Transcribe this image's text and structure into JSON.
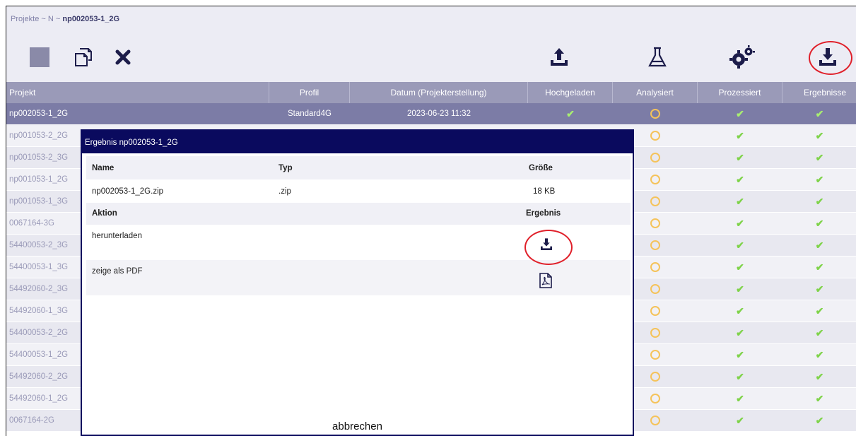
{
  "breadcrumb": {
    "path": "Projekte ~ N ~ ",
    "current": "np002053-1_2G"
  },
  "toolbar": {
    "left_icons": [
      "stop-square-icon",
      "copy-icon",
      "delete-x-icon"
    ],
    "right_icons": [
      "upload-icon",
      "flask-icon",
      "gears-icon",
      "download-icon"
    ]
  },
  "table": {
    "headers": {
      "project": "Projekt",
      "profile": "Profil",
      "date": "Datum (Projekterstellung)",
      "uploaded": "Hochgeladen",
      "analyzed": "Analysiert",
      "processed": "Prozessiert",
      "results": "Ergebnisse"
    },
    "selected": {
      "project": "np002053-1_2G",
      "profile": "Standard4G",
      "date": "2023-06-23 11:32"
    },
    "rows": [
      {
        "project": "np001053-2_2G"
      },
      {
        "project": "np001053-2_3G"
      },
      {
        "project": "np001053-1_2G"
      },
      {
        "project": "np001053-1_3G"
      },
      {
        "project": "0067164-3G"
      },
      {
        "project": "54400053-2_3G"
      },
      {
        "project": "54400053-1_3G"
      },
      {
        "project": "54492060-2_3G"
      },
      {
        "project": "54492060-1_3G"
      },
      {
        "project": "54400053-2_2G"
      },
      {
        "project": "54400053-1_2G"
      },
      {
        "project": "54492060-2_2G"
      },
      {
        "project": "54492060-1_2G"
      },
      {
        "project": "0067164-2G"
      }
    ],
    "status_icons": {
      "check": "✔",
      "pending": "ring"
    }
  },
  "modal": {
    "title": "Ergebnis np002053-1_2G",
    "file_headers": {
      "name": "Name",
      "type": "Typ",
      "size": "Größe"
    },
    "file": {
      "name": "np002053-1_2G.zip",
      "type": ".zip",
      "size": "18 KB"
    },
    "action_headers": {
      "action": "Aktion",
      "result": "Ergebnis"
    },
    "actions": [
      {
        "label": "herunterladen",
        "icon": "download-icon"
      },
      {
        "label": "zeige als PDF",
        "icon": "pdf-icon"
      }
    ],
    "cancel_label": "abbrechen"
  },
  "colors": {
    "navy": "#0a0a5e",
    "header": "#9a9ab8",
    "selected": "#7c7ca6",
    "check": "#7fd34a",
    "ring": "#f5c35a",
    "annotation": "#e0202a"
  }
}
